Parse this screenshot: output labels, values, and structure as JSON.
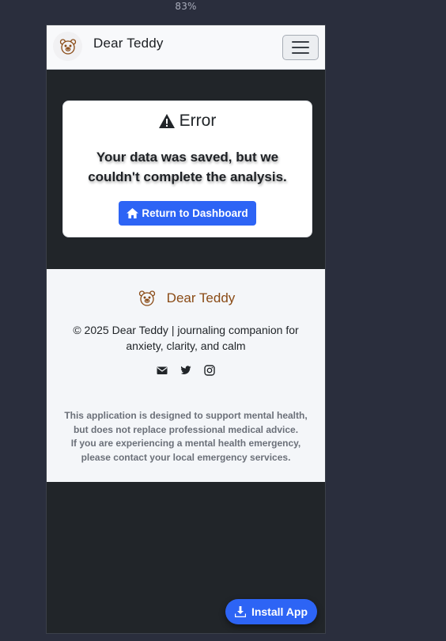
{
  "browser": {
    "zoom": "83%"
  },
  "navbar": {
    "brand_name": "Dear Teddy",
    "logo_icon": "teddy-bear-icon",
    "menu_icon": "hamburger-menu-icon"
  },
  "error": {
    "title": "Error",
    "icon": "warning-triangle-icon",
    "message": "Your data was saved, but we couldn't complete the analysis.",
    "button_label": "Return to Dashboard",
    "button_icon": "home-icon"
  },
  "footer": {
    "brand_name": "Dear Teddy",
    "copyright": "© 2025 Dear Teddy | journaling companion for anxiety, clarity, and calm",
    "social_icons": [
      "envelope-icon",
      "twitter-icon",
      "instagram-icon"
    ],
    "disclaimer_line1": "This application is designed to support mental health, but does not replace professional medical advice.",
    "disclaimer_line2": "If you are experiencing a mental health emergency, please contact your local emergency services."
  },
  "install": {
    "label": "Install App",
    "icon": "download-icon"
  },
  "colors": {
    "primary": "#2d64f5",
    "brand_accent": "#8a4b16",
    "dark_bg": "#212529",
    "light_bg": "#f4f6f9"
  }
}
